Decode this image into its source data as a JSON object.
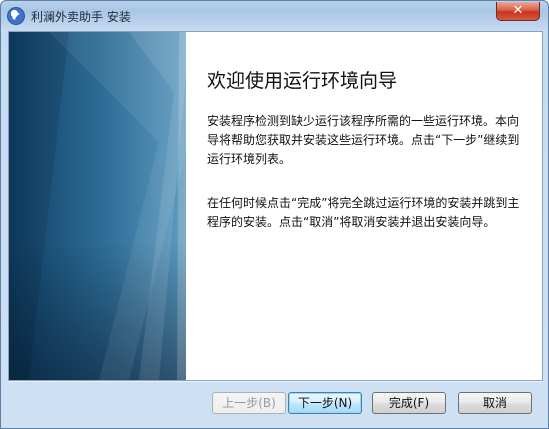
{
  "window": {
    "title": "利澜外卖助手 安装",
    "close_label": "✕",
    "app_icon": "app-logo-icon"
  },
  "wizard": {
    "heading": "欢迎使用运行环境向导",
    "paragraph1": "安装程序检测到缺少运行该程序所需的一些运行环境。本向导将帮助您获取并安装这些运行环境。点击“下一步”继续到运行环境列表。",
    "paragraph2": "在任何时候点击“完成”将完全跳过运行环境的安装并跳到主程序的安装。点击“取消”将取消安装并退出安装向导。"
  },
  "buttons": {
    "back": "上一步(B)",
    "next": "下一步(N)",
    "finish": "完成(F)",
    "cancel": "取消"
  },
  "colors": {
    "banner_dark": "#0f3f66",
    "banner_light": "#5f9bc0",
    "default_button_border": "#3c7fb1",
    "close_button": "#c8341f"
  }
}
